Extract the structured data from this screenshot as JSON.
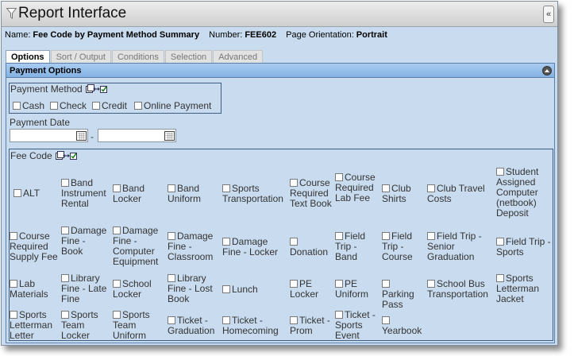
{
  "window": {
    "title": "Report Interface"
  },
  "info": {
    "name_label": "Name:",
    "name_value": "Fee Code by Payment Method Summary",
    "number_label": "Number:",
    "number_value": "FEE602",
    "orientation_label": "Page Orientation:",
    "orientation_value": "Portrait"
  },
  "tabs": [
    "Options",
    "Sort / Output",
    "Conditions",
    "Selection",
    "Advanced"
  ],
  "panel": {
    "title": "Payment Options"
  },
  "payment_method": {
    "label": "Payment Method",
    "options": [
      "Cash",
      "Check",
      "Credit",
      "Online Payment"
    ]
  },
  "payment_date": {
    "label": "Payment Date",
    "separator": "-"
  },
  "fee_code": {
    "label": "Fee Code",
    "options": [
      "ALT",
      "Band Instrument Rental",
      "Band Locker",
      "Band Uniform",
      "Sports Transportation",
      "Course Required Text Book",
      "Course Required Lab Fee",
      "Club Shirts",
      "Club Travel Costs",
      "Student Assigned Computer (netbook) Deposit",
      "Course Required Supply Fee",
      "Damage Fine - Book",
      "Damage Fine - Computer Equipment",
      "Damage Fine - Classroom",
      "Damage Fine - Locker",
      "Donation",
      "Field Trip - Band",
      "Field Trip - Course",
      "Field Trip - Senior Graduation",
      "Field Trip - Sports",
      "Lab Materials",
      "Library Fine - Late Fine",
      "School Locker",
      "Library Fine - Lost Book",
      "Lunch",
      "PE Locker",
      "PE Uniform",
      "Parking Pass",
      "School Bus Transportation",
      "Sports Letterman Jacket",
      "Sports Letterman Letter",
      "Sports Team Locker",
      "Sports Team Uniform",
      "Ticket - Graduation",
      "Ticket - Homecoming",
      "Ticket - Prom",
      "Ticket - Sports Event",
      "Yearbook"
    ]
  },
  "icons": {
    "funnel": "funnel-icon",
    "collapse_sidebar": "double-chevron-left-icon",
    "collapse_panel": "collapse-up-icon",
    "select_all": "select-all-icon",
    "calendar": "calendar-icon"
  }
}
